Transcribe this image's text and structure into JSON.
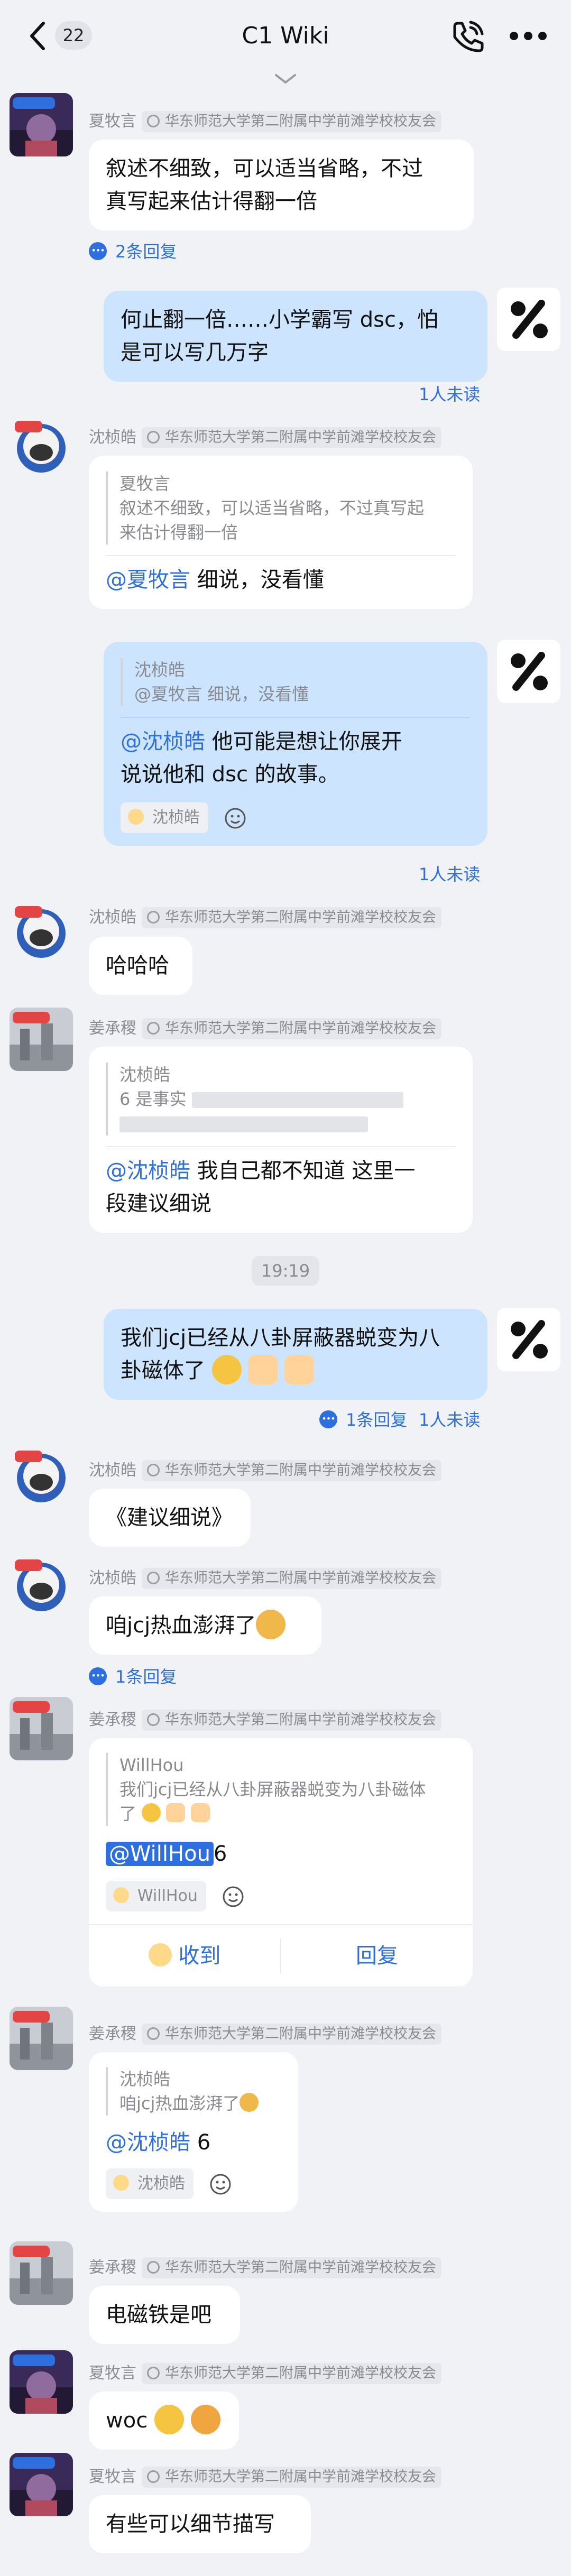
{
  "header": {
    "title": "C1 Wiki",
    "unread_count": "22"
  },
  "users": {
    "xia": "夏牧言",
    "shen": "沈桢皓",
    "jiang": "姜承稷"
  },
  "group_tag": "华东师范大学第二附属中学前滩学校校友会",
  "messages": {
    "m1": {
      "text_line1": "叙述不细致，可以适当省略，不过",
      "text_line2": "真写起来估计得翻一倍",
      "reply_count": "2条回复"
    },
    "m2": {
      "text_line1": "何止翻一倍……小学霸写 dsc，怕",
      "text_line2": "是可以写几万字",
      "unread": "1人未读"
    },
    "m3": {
      "quote_name": "夏牧言",
      "quote_line1": "叙述不细致，可以适当省略，不过真写起",
      "quote_line2": "来估计得翻一倍",
      "mention": "@夏牧言",
      "text": " 细说，没看懂"
    },
    "m4": {
      "quote_name": "沈桢皓",
      "quote_text": "@夏牧言 细说，没看懂",
      "mention": "@沈桢皓",
      "text_line1": " 他可能是想让你展开",
      "text_line2": "说说他和 dsc 的故事。",
      "chip_name": "沈桢皓",
      "unread": "1人未读"
    },
    "m5": {
      "text": "哈哈哈"
    },
    "m6": {
      "quote_name": "沈桢皓",
      "quote_prefix": "6 是事实",
      "mention": "@沈桢皓",
      "text_line1": " 我自己都不知道 这里一",
      "text_line2": "段建议细说"
    },
    "time_divider": "19:19",
    "m7": {
      "text_line1": "我们jcj已经从八卦屏蔽器蜕变为八",
      "text_line2": "卦磁体了",
      "reply_count": "1条回复",
      "unread": "1人未读"
    },
    "m8": {
      "text": "《建议细说》"
    },
    "m9": {
      "text": "咱jcj热血澎湃了",
      "reply_count": "1条回复"
    },
    "m10": {
      "quote_name": "WillHou",
      "quote_line1": "我们jcj已经从八卦屏蔽器蜕变为八卦磁体",
      "quote_line2": "了",
      "mention": "@WillHou",
      "text": "6",
      "chip_name": "WillHou",
      "action_ack": "收到",
      "action_reply": "回复"
    },
    "m11": {
      "quote_name": "沈桢皓",
      "quote_text": "咱jcj热血澎湃了",
      "mention": "@沈桢皓",
      "text": " 6",
      "chip_name": "沈桢皓"
    },
    "m12": {
      "text": "电磁铁是吧"
    },
    "m13": {
      "text": "woc"
    },
    "m14": {
      "text": "有些可以细节描写"
    }
  },
  "colors": {
    "accent": "#2d6fdf",
    "my_bubble": "#cde4ff",
    "background": "#f1f2f6"
  },
  "icons": {
    "back": "chevron-left-icon",
    "call": "phone-call-icon",
    "more": "more-dots-icon",
    "collapse": "chevron-down-icon"
  }
}
